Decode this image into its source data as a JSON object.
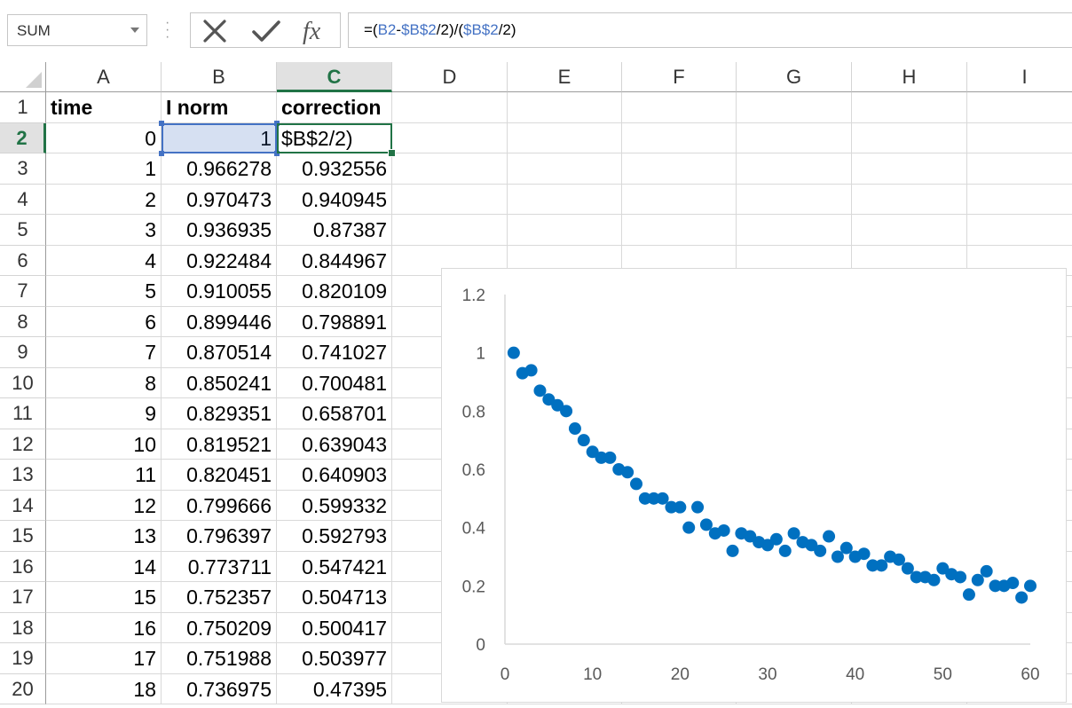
{
  "formula_bar": {
    "name_box": "SUM",
    "formula_parts": [
      {
        "text": "=(",
        "ref": false
      },
      {
        "text": "B2",
        "ref": true
      },
      {
        "text": "-",
        "ref": false
      },
      {
        "text": "$B$2",
        "ref": true
      },
      {
        "text": "/2)/(",
        "ref": false
      },
      {
        "text": "$B$2",
        "ref": true
      },
      {
        "text": "/2)",
        "ref": false
      }
    ],
    "cancel_icon": "close-icon",
    "enter_icon": "check-icon",
    "fx_label": "fx"
  },
  "columns": [
    "A",
    "B",
    "C",
    "D",
    "E",
    "F",
    "G",
    "H",
    "I"
  ],
  "active_column": "C",
  "active_row": 2,
  "rows": [
    {
      "row": "1",
      "a": "time",
      "b": "I norm",
      "c": "correction"
    },
    {
      "row": "2",
      "a": "0",
      "b": "1",
      "c": "$B$2/2)"
    },
    {
      "row": "3",
      "a": "1",
      "b": "0.966278",
      "c": "0.932556"
    },
    {
      "row": "4",
      "a": "2",
      "b": "0.970473",
      "c": "0.940945"
    },
    {
      "row": "5",
      "a": "3",
      "b": "0.936935",
      "c": "0.87387"
    },
    {
      "row": "6",
      "a": "4",
      "b": "0.922484",
      "c": "0.844967"
    },
    {
      "row": "7",
      "a": "5",
      "b": "0.910055",
      "c": "0.820109"
    },
    {
      "row": "8",
      "a": "6",
      "b": "0.899446",
      "c": "0.798891"
    },
    {
      "row": "9",
      "a": "7",
      "b": "0.870514",
      "c": "0.741027"
    },
    {
      "row": "10",
      "a": "8",
      "b": "0.850241",
      "c": "0.700481"
    },
    {
      "row": "11",
      "a": "9",
      "b": "0.829351",
      "c": "0.658701"
    },
    {
      "row": "12",
      "a": "10",
      "b": "0.819521",
      "c": "0.639043"
    },
    {
      "row": "13",
      "a": "11",
      "b": "0.820451",
      "c": "0.640903"
    },
    {
      "row": "14",
      "a": "12",
      "b": "0.799666",
      "c": "0.599332"
    },
    {
      "row": "15",
      "a": "13",
      "b": "0.796397",
      "c": "0.592793"
    },
    {
      "row": "16",
      "a": "14",
      "b": "0.773711",
      "c": "0.547421"
    },
    {
      "row": "17",
      "a": "15",
      "b": "0.752357",
      "c": "0.504713"
    },
    {
      "row": "18",
      "a": "16",
      "b": "0.750209",
      "c": "0.500417"
    },
    {
      "row": "19",
      "a": "17",
      "b": "0.751988",
      "c": "0.503977"
    },
    {
      "row": "20",
      "a": "18",
      "b": "0.736975",
      "c": "0.47395"
    }
  ],
  "chart_data": {
    "type": "scatter",
    "title": "",
    "xlabel": "",
    "ylabel": "",
    "xlim": [
      0,
      60
    ],
    "ylim": [
      0,
      1.2
    ],
    "x_ticks": [
      "0",
      "10",
      "20",
      "30",
      "40",
      "50",
      "60"
    ],
    "y_ticks": [
      "0",
      "0.2",
      "0.4",
      "0.6",
      "0.8",
      "1",
      "1.2"
    ],
    "grid": false,
    "color": "#0070c0",
    "x": [
      1,
      2,
      3,
      4,
      5,
      6,
      7,
      8,
      9,
      10,
      11,
      12,
      13,
      14,
      15,
      16,
      17,
      18,
      19,
      20,
      21,
      22,
      23,
      24,
      25,
      26,
      27,
      28,
      29,
      30,
      31,
      32,
      33,
      34,
      35,
      36,
      37,
      38,
      39,
      40,
      41,
      42,
      43,
      44,
      45,
      46,
      47,
      48,
      49,
      50,
      51,
      52,
      53,
      54,
      55,
      56,
      57,
      58,
      59,
      60
    ],
    "y": [
      1.0,
      0.93,
      0.94,
      0.87,
      0.84,
      0.82,
      0.8,
      0.74,
      0.7,
      0.66,
      0.64,
      0.64,
      0.6,
      0.59,
      0.55,
      0.5,
      0.5,
      0.5,
      0.47,
      0.47,
      0.4,
      0.47,
      0.41,
      0.38,
      0.39,
      0.32,
      0.38,
      0.37,
      0.35,
      0.34,
      0.36,
      0.32,
      0.38,
      0.35,
      0.34,
      0.32,
      0.37,
      0.3,
      0.33,
      0.3,
      0.31,
      0.27,
      0.27,
      0.3,
      0.29,
      0.26,
      0.23,
      0.23,
      0.22,
      0.26,
      0.24,
      0.23,
      0.17,
      0.22,
      0.25,
      0.2,
      0.2,
      0.21,
      0.16,
      0.2
    ]
  }
}
